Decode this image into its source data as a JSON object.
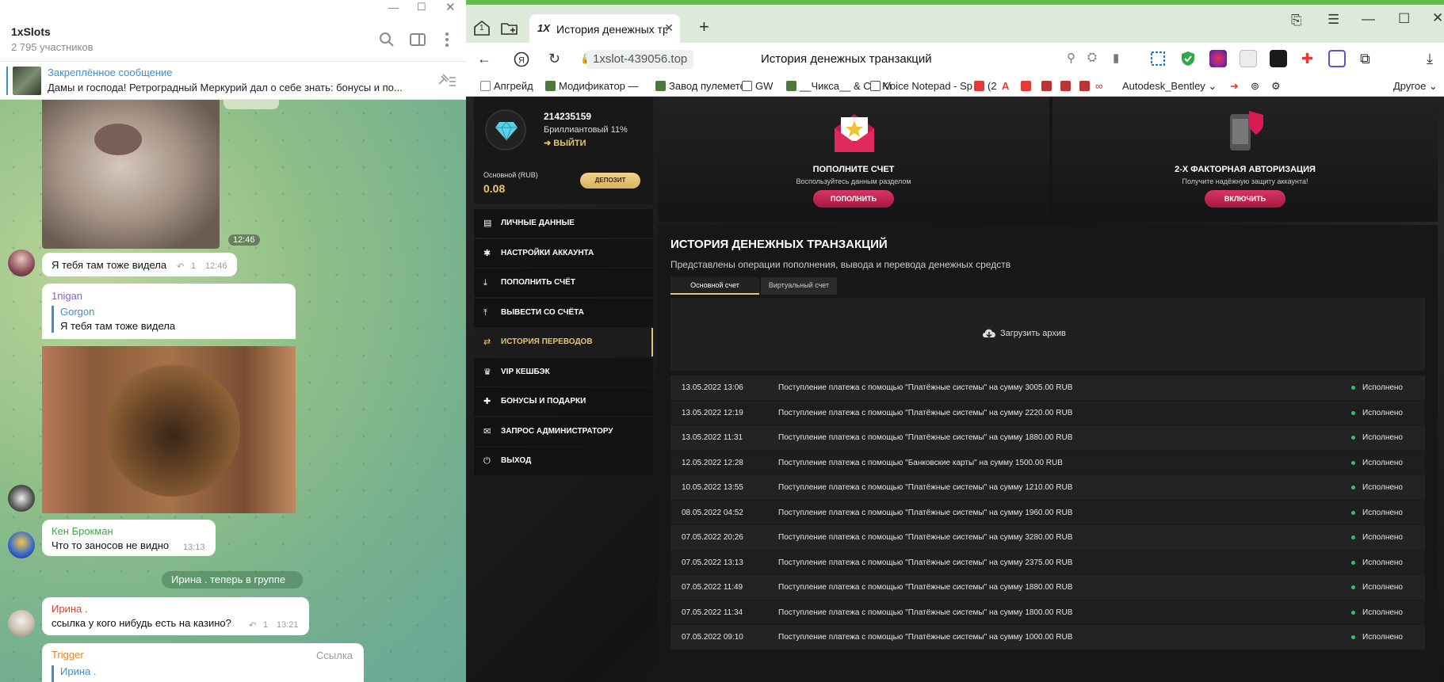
{
  "telegram": {
    "chat_title": "1xSlots",
    "members": "2 795 участников",
    "pinned_title": "Закреплённое сообщение",
    "pinned_text": "Дамы и господа!  Ретроградный Меркурий дал о себе знать: бонусы и по...",
    "msg1_time": "12:46",
    "msg2_text": "Я тебя там тоже видела",
    "msg2_replies": "1",
    "msg2_time": "12:46",
    "msg3_author": "1nigan",
    "msg3_quote_author": "Gorgon",
    "msg3_quote_text": "Я тебя там тоже видела",
    "msg4_author": "Кен Брокман",
    "msg4_text": "Что то заносов не видно",
    "msg4_time": "13:13",
    "service_msg": "Ирина . теперь в группе",
    "msg5_author": "Ирина .",
    "msg5_text": "ссылка у кого нибудь есть на казино?",
    "msg5_replies": "1",
    "msg5_time": "13:21",
    "msg6_author": "Trigger",
    "msg6_tag": "Ссылка",
    "msg6_quote_author": "Ирина ."
  },
  "browser": {
    "tab_count": "1",
    "tab_title": "История денежных тра",
    "url": "1xslot-439056.top",
    "page_title": "История денежных транзакций",
    "bookmarks": [
      "Апгрейд",
      "Модификатор —",
      "Завод пулеметов",
      "GW",
      "__Чикса__ & Co: Ki",
      "Voice Notepad - Sp",
      "(2",
      "Autodesk_Bentley",
      "Другое"
    ]
  },
  "site": {
    "user_id": "214235159",
    "level": "Бриллиантовый 11%",
    "logout": "ВЫЙТИ",
    "balance_label": "Основной (RUB)",
    "balance": "0.08",
    "deposit_btn": "ДЕПОЗИТ",
    "menu": [
      {
        "label": "ЛИЧНЫЕ ДАННЫЕ",
        "icon": "▤",
        "active": false
      },
      {
        "label": "НАСТРОЙКИ АККАУНТА",
        "icon": "✱",
        "active": false
      },
      {
        "label": "ПОПОЛНИТЬ СЧЁТ",
        "icon": "⤓",
        "active": false
      },
      {
        "label": "ВЫВЕСТИ СО СЧЁТА",
        "icon": "⤒",
        "active": false
      },
      {
        "label": "ИСТОРИЯ ПЕРЕВОДОВ",
        "icon": "⇄",
        "active": true
      },
      {
        "label": "VIP КЕШБЭК",
        "icon": "♛",
        "active": false
      },
      {
        "label": "БОНУСЫ И ПОДАРКИ",
        "icon": "✚",
        "active": false
      },
      {
        "label": "ЗАПРОС АДМИНИСТРАТОРУ",
        "icon": "✉",
        "active": false
      },
      {
        "label": "ВЫХОД",
        "icon": "⏻",
        "active": false
      }
    ],
    "card1": {
      "title": "ПОПОЛНИТЕ СЧЕТ",
      "sub": "Воспользуйтесь данным разделом",
      "btn": "ПОПОЛНИТЬ"
    },
    "card2": {
      "title": "2-Х ФАКТОРНАЯ АВТОРИЗАЦИЯ",
      "sub": "Получите надёжную защиту аккаунта!",
      "btn": "ВКЛЮЧИТЬ"
    },
    "history_title": "ИСТОРИЯ ДЕНЕЖНЫХ ТРАНЗАКЦИЙ",
    "history_sub": "Представлены операции пополнения, вывода и перевода денежных средств",
    "tab_main": "Основной счет",
    "tab_virtual": "Виртуальный счет",
    "archive": "Загрузить архив",
    "transactions": [
      {
        "date": "13.05.2022 13:06",
        "text": "Поступление платежа с помощью \"Платёжные системы\" на сумму 3005.00 RUB",
        "status": "Исполнено"
      },
      {
        "date": "13.05.2022 12:19",
        "text": "Поступление платежа с помощью \"Платёжные системы\" на сумму 2220.00 RUB",
        "status": "Исполнено"
      },
      {
        "date": "13.05.2022 11:31",
        "text": "Поступление платежа с помощью \"Платёжные системы\" на сумму 1880.00 RUB",
        "status": "Исполнено"
      },
      {
        "date": "12.05.2022 12:28",
        "text": "Поступление платежа с помощью \"Банковские карты\" на сумму 1500.00 RUB",
        "status": "Исполнено"
      },
      {
        "date": "10.05.2022 13:55",
        "text": "Поступление платежа с помощью \"Платёжные системы\" на сумму 1210.00 RUB",
        "status": "Исполнено"
      },
      {
        "date": "08.05.2022 04:52",
        "text": "Поступление платежа с помощью \"Платёжные системы\" на сумму 1960.00 RUB",
        "status": "Исполнено"
      },
      {
        "date": "07.05.2022 20:26",
        "text": "Поступление платежа с помощью \"Платёжные системы\" на сумму 3280.00 RUB",
        "status": "Исполнено"
      },
      {
        "date": "07.05.2022 13:13",
        "text": "Поступление платежа с помощью \"Платёжные системы\" на сумму 2375.00 RUB",
        "status": "Исполнено"
      },
      {
        "date": "07.05.2022 11:49",
        "text": "Поступление платежа с помощью \"Платёжные системы\" на сумму 1880.00 RUB",
        "status": "Исполнено"
      },
      {
        "date": "07.05.2022 11:34",
        "text": "Поступление платежа с помощью \"Платёжные системы\" на сумму 1800.00 RUB",
        "status": "Исполнено"
      },
      {
        "date": "07.05.2022 09:10",
        "text": "Поступление платежа с помощью \"Платёжные системы\" на сумму 1000.00 RUB",
        "status": "Исполнено"
      }
    ]
  }
}
